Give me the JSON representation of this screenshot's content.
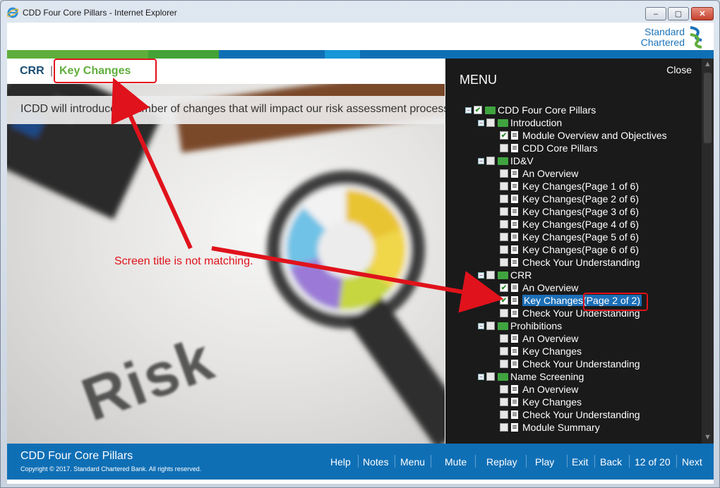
{
  "window": {
    "title": "CDD Four Core Pillars - Internet Explorer",
    "min_glyph": "–",
    "max_glyph": "▢",
    "close_glyph": "✕"
  },
  "brand": {
    "line1": "Standard",
    "line2": "Chartered",
    "colors": {
      "blue": "#1c73b8",
      "green": "#5fae3b",
      "band_dark_blue": "#0f6fb5",
      "band_light_blue": "#1596d6"
    }
  },
  "header": {
    "section": "CRR",
    "separator": "|",
    "page_title": "Key Changes"
  },
  "hero": {
    "intro": "ICDD will introduce a number of changes that will impact our risk assessment process",
    "image_word": "Risk"
  },
  "menu": {
    "title": "MENU",
    "close": "Close",
    "items": [
      {
        "label": "CDD Four Core Pillars",
        "level": 0,
        "kind": "folder",
        "checked": true
      },
      {
        "label": "Introduction",
        "level": 1,
        "kind": "folder",
        "checked": false
      },
      {
        "label": "Module Overview and Objectives",
        "level": 2,
        "kind": "doc",
        "checked": true
      },
      {
        "label": "CDD Core Pillars",
        "level": 2,
        "kind": "doc",
        "checked": false
      },
      {
        "label": "ID&V",
        "level": 1,
        "kind": "folder",
        "checked": false
      },
      {
        "label": "An Overview",
        "level": 2,
        "kind": "doc",
        "checked": false
      },
      {
        "label": "Key Changes(Page 1 of 6)",
        "level": 2,
        "kind": "doc",
        "checked": false
      },
      {
        "label": "Key Changes(Page 2 of 6)",
        "level": 2,
        "kind": "doc",
        "checked": false
      },
      {
        "label": "Key Changes(Page 3 of 6)",
        "level": 2,
        "kind": "doc",
        "checked": false
      },
      {
        "label": "Key Changes(Page 4 of 6)",
        "level": 2,
        "kind": "doc",
        "checked": false
      },
      {
        "label": "Key Changes(Page 5 of 6)",
        "level": 2,
        "kind": "doc",
        "checked": false
      },
      {
        "label": "Key Changes(Page 6 of 6)",
        "level": 2,
        "kind": "doc",
        "checked": false
      },
      {
        "label": "Check Your Understanding",
        "level": 2,
        "kind": "doc",
        "checked": false
      },
      {
        "label": "CRR",
        "level": 1,
        "kind": "folder",
        "checked": false
      },
      {
        "label": "An Overview",
        "level": 2,
        "kind": "doc",
        "checked": true
      },
      {
        "label": "Key Changes(Page 2 of 2)",
        "level": 2,
        "kind": "doc",
        "checked": true,
        "selected": true
      },
      {
        "label": "Check Your Understanding",
        "level": 2,
        "kind": "doc",
        "checked": false
      },
      {
        "label": "Prohibitions",
        "level": 1,
        "kind": "folder",
        "checked": false
      },
      {
        "label": "An Overview",
        "level": 2,
        "kind": "doc",
        "checked": false
      },
      {
        "label": "Key Changes",
        "level": 2,
        "kind": "doc",
        "checked": false
      },
      {
        "label": "Check Your Understanding",
        "level": 2,
        "kind": "doc",
        "checked": false
      },
      {
        "label": "Name Screening",
        "level": 1,
        "kind": "folder",
        "checked": false
      },
      {
        "label": "An Overview",
        "level": 2,
        "kind": "doc",
        "checked": false
      },
      {
        "label": "Key Changes",
        "level": 2,
        "kind": "doc",
        "checked": false
      },
      {
        "label": "Check Your Understanding",
        "level": 2,
        "kind": "doc",
        "checked": false
      },
      {
        "label": "Module Summary",
        "level": 2,
        "kind": "doc",
        "checked": false
      }
    ]
  },
  "footer": {
    "course_title": "CDD Four Core Pillars",
    "copyright": "Copyright © 2017. Standard Chartered Bank. All rights reserved.",
    "nav": {
      "help": "Help",
      "notes": "Notes",
      "menu": "Menu",
      "mute": "Mute",
      "replay": "Replay",
      "play": "Play",
      "exit": "Exit",
      "back": "Back",
      "page_counter": "12 of 20",
      "next": "Next"
    }
  },
  "annotation": {
    "text": "Screen title is not matching.",
    "color": "#e0121b"
  }
}
